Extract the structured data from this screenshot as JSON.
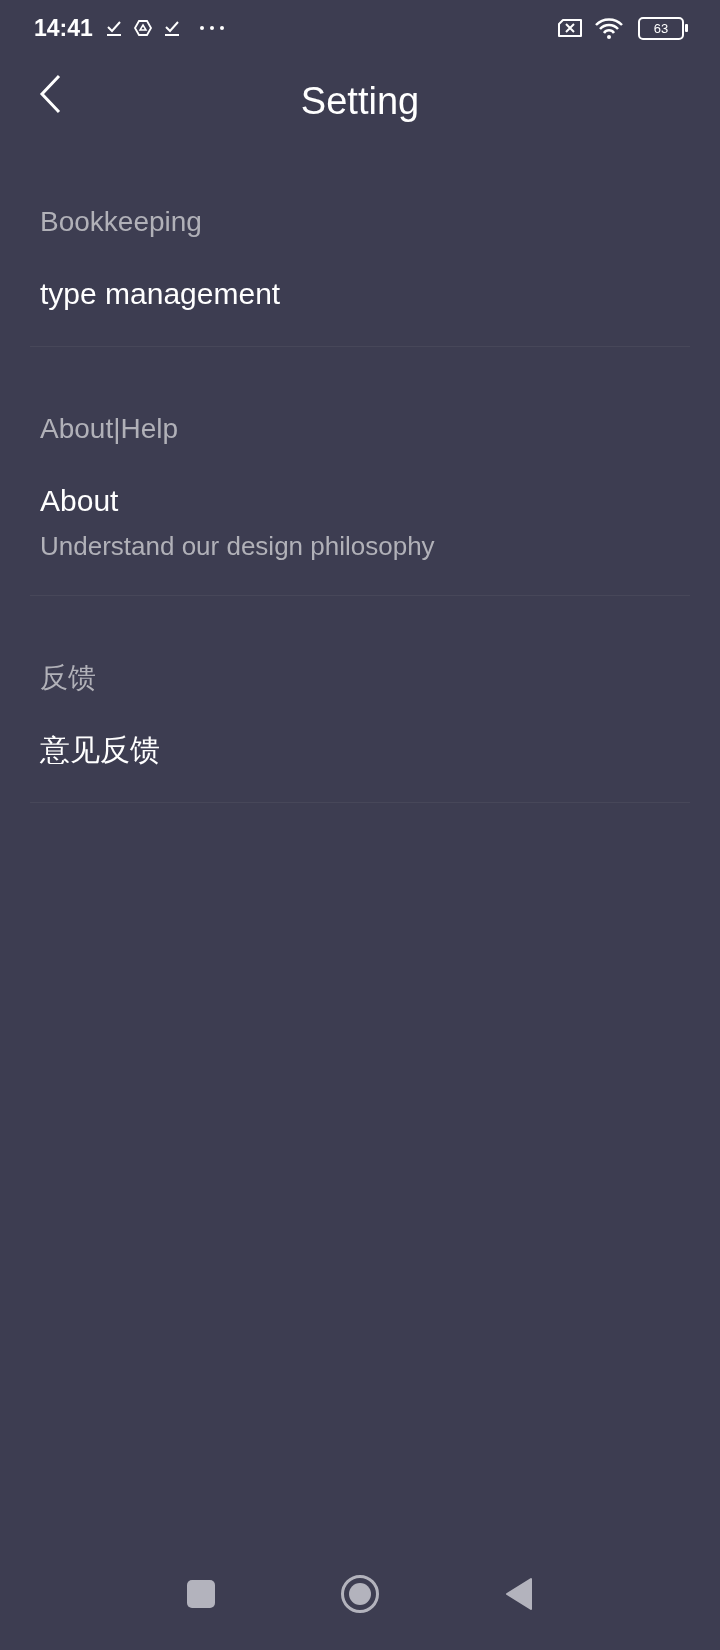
{
  "status_bar": {
    "time": "14:41",
    "battery": "63"
  },
  "header": {
    "title": "Setting"
  },
  "sections": [
    {
      "title": "Bookkeeping",
      "items": [
        {
          "title": "type management"
        }
      ]
    },
    {
      "title": "About|Help",
      "items": [
        {
          "title": "About",
          "subtitle": "Understand our design philosophy"
        }
      ]
    },
    {
      "title": "反馈",
      "items": [
        {
          "title": "意见反馈"
        }
      ]
    }
  ]
}
